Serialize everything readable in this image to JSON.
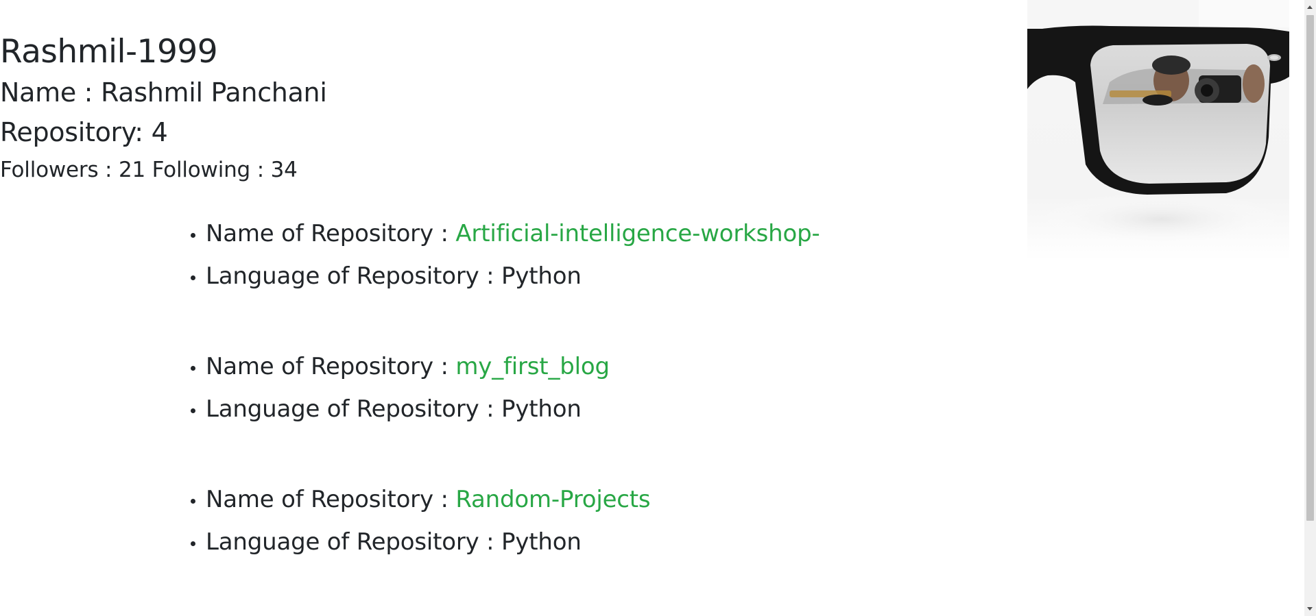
{
  "profile": {
    "username": "Rashmil-1999",
    "name": "Name : Rashmil Panchani",
    "repository_count": "Repository: 4",
    "follow_stats": "Followers : 21 Following : 34",
    "avatar_icon": "avatar-photo-sunglasses-reflection"
  },
  "repositories": [
    {
      "name_label": "Name of Repository : ",
      "name": "Artificial-intelligence-workshop-",
      "language_label": "Language of Repository : Python"
    },
    {
      "name_label": "Name of Repository : ",
      "name": "my_first_blog",
      "language_label": "Language of Repository : Python"
    },
    {
      "name_label": "Name of Repository : ",
      "name": "Random-Projects",
      "language_label": "Language of Repository : Python"
    }
  ],
  "colors": {
    "text": "#212529",
    "link": "#28a745",
    "background": "#ffffff"
  }
}
